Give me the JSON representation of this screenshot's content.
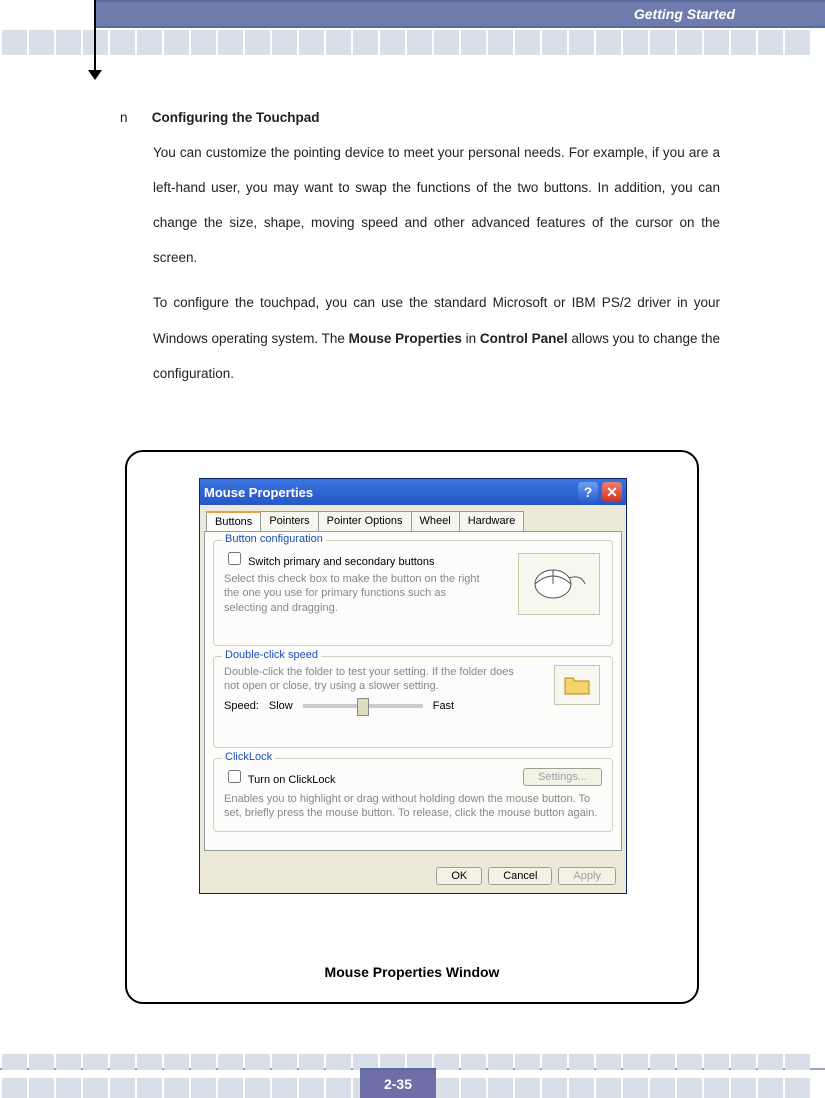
{
  "header": {
    "title": "Getting Started"
  },
  "body": {
    "n": "n",
    "heading": "Configuring the Touchpad",
    "p1": "You can customize the pointing device to meet your personal needs.  For example, if you are a left-hand user, you may want to swap the functions of the two buttons.  In addition, you can change the size, shape, moving speed and other advanced features of the cursor on the screen.",
    "p2a": "To configure the touchpad, you can use the standard Microsoft or IBM PS/2 driver in your Windows operating system.  The ",
    "p2b": "Mouse Properties",
    "p2c": " in ",
    "p2d": "Control Panel",
    "p2e": " allows you to change the configuration."
  },
  "dialog": {
    "title": "Mouse Properties",
    "tabs": [
      "Buttons",
      "Pointers",
      "Pointer Options",
      "Wheel",
      "Hardware"
    ],
    "g1": {
      "legend": "Button configuration",
      "chk": "Switch primary and secondary buttons",
      "desc": "Select this check box to make the button on the right the one you use for primary functions such as selecting and dragging."
    },
    "g2": {
      "legend": "Double-click speed",
      "desc": "Double-click the folder to test your setting. If the folder does not open or close, try using a slower setting.",
      "speed": "Speed:",
      "slow": "Slow",
      "fast": "Fast"
    },
    "g3": {
      "legend": "ClickLock",
      "chk": "Turn on ClickLock",
      "settings": "Settings...",
      "desc": "Enables you to highlight or drag without holding down the mouse button. To set, briefly press the mouse button. To release, click the mouse button again."
    },
    "buttons": {
      "ok": "OK",
      "cancel": "Cancel",
      "apply": "Apply"
    }
  },
  "caption": "Mouse Properties Window",
  "page": "2-35"
}
